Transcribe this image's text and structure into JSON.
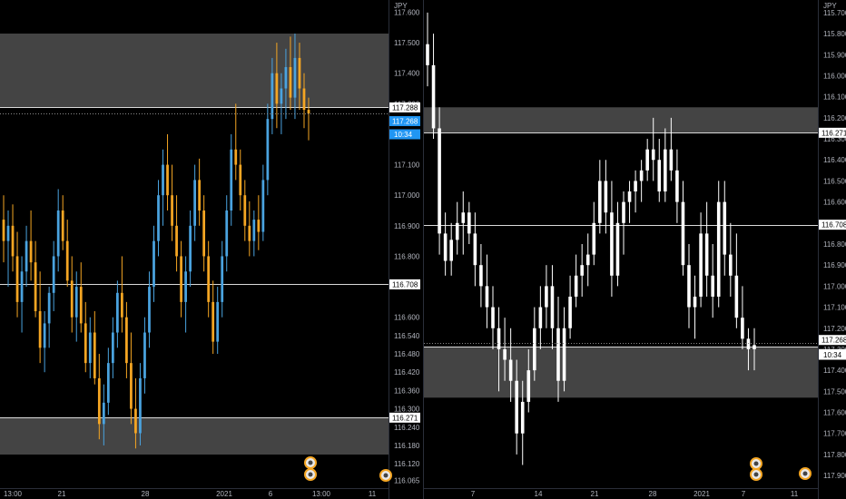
{
  "colors": {
    "background": "#000000",
    "zone": "#444444",
    "level_line": "#d9d9d9",
    "left_up": "#4aa3df",
    "left_down": "#f5a623",
    "right_candle": "#ffffff",
    "price_badge": "#2196f3",
    "axis_text": "#b2b5be"
  },
  "left": {
    "currency": "JPY",
    "price_labels": [
      "117.600",
      "117.500",
      "117.400",
      "117.300",
      "117.200",
      "117.100",
      "117.000",
      "116.900",
      "116.800",
      "116.700",
      "116.600",
      "116.540",
      "116.480",
      "116.420",
      "116.360",
      "116.300",
      "116.240",
      "116.180",
      "116.120",
      "116.065"
    ],
    "level_labels": [
      "117.288",
      "116.708",
      "116.271"
    ],
    "last_price": "117.268",
    "countdown": "10:34",
    "time_labels": [
      "13:00",
      "21",
      "28",
      "2021",
      "6",
      "13:00",
      "11"
    ]
  },
  "right": {
    "currency": "JPY",
    "scale_mode": "inverted",
    "price_labels": [
      "115.700",
      "115.800",
      "115.900",
      "116.000",
      "116.100",
      "116.200",
      "116.300",
      "116.400",
      "116.500",
      "116.600",
      "116.700",
      "116.800",
      "116.900",
      "117.000",
      "117.100",
      "117.200",
      "117.300",
      "117.400",
      "117.500",
      "117.600",
      "117.700",
      "117.800",
      "117.900"
    ],
    "level_labels": [
      "116.271",
      "116.708",
      "117.268",
      "117.288"
    ],
    "countdown": "10:34",
    "time_labels": [
      "7",
      "14",
      "21",
      "28",
      "2021",
      "7",
      "11"
    ]
  },
  "chart_data": [
    {
      "type": "candlestick",
      "title": "",
      "ylabel": "JPY",
      "ylim": [
        116.04,
        117.64
      ],
      "x_ticks": [
        "13:00",
        "21",
        "28",
        "2021",
        "6",
        "13:00",
        "11"
      ],
      "levels": [
        117.288,
        116.708,
        116.271
      ],
      "zones": [
        [
          117.288,
          117.53
        ],
        [
          116.15,
          116.271
        ]
      ],
      "last_price": 117.268,
      "candles": [
        {
          "o": 116.92,
          "h": 117.0,
          "l": 116.78,
          "c": 116.85
        },
        {
          "o": 116.85,
          "h": 116.95,
          "l": 116.7,
          "c": 116.9
        },
        {
          "o": 116.9,
          "h": 116.97,
          "l": 116.75,
          "c": 116.8
        },
        {
          "o": 116.8,
          "h": 116.88,
          "l": 116.6,
          "c": 116.65
        },
        {
          "o": 116.65,
          "h": 116.8,
          "l": 116.55,
          "c": 116.75
        },
        {
          "o": 116.75,
          "h": 116.9,
          "l": 116.7,
          "c": 116.85
        },
        {
          "o": 116.85,
          "h": 116.95,
          "l": 116.72,
          "c": 116.78
        },
        {
          "o": 116.78,
          "h": 116.85,
          "l": 116.6,
          "c": 116.62
        },
        {
          "o": 116.62,
          "h": 116.75,
          "l": 116.45,
          "c": 116.5
        },
        {
          "o": 116.5,
          "h": 116.62,
          "l": 116.42,
          "c": 116.58
        },
        {
          "o": 116.58,
          "h": 116.7,
          "l": 116.5,
          "c": 116.68
        },
        {
          "o": 116.68,
          "h": 116.85,
          "l": 116.62,
          "c": 116.8
        },
        {
          "o": 116.8,
          "h": 117.02,
          "l": 116.75,
          "c": 116.95
        },
        {
          "o": 116.95,
          "h": 117.0,
          "l": 116.82,
          "c": 116.85
        },
        {
          "o": 116.85,
          "h": 116.92,
          "l": 116.7,
          "c": 116.72
        },
        {
          "o": 116.72,
          "h": 116.8,
          "l": 116.55,
          "c": 116.6
        },
        {
          "o": 116.6,
          "h": 116.75,
          "l": 116.52,
          "c": 116.7
        },
        {
          "o": 116.7,
          "h": 116.78,
          "l": 116.55,
          "c": 116.58
        },
        {
          "o": 116.58,
          "h": 116.65,
          "l": 116.42,
          "c": 116.45
        },
        {
          "o": 116.45,
          "h": 116.6,
          "l": 116.4,
          "c": 116.55
        },
        {
          "o": 116.55,
          "h": 116.62,
          "l": 116.38,
          "c": 116.4
        },
        {
          "o": 116.4,
          "h": 116.48,
          "l": 116.2,
          "c": 116.25
        },
        {
          "o": 116.25,
          "h": 116.38,
          "l": 116.18,
          "c": 116.32
        },
        {
          "o": 116.32,
          "h": 116.5,
          "l": 116.28,
          "c": 116.45
        },
        {
          "o": 116.45,
          "h": 116.6,
          "l": 116.4,
          "c": 116.55
        },
        {
          "o": 116.55,
          "h": 116.72,
          "l": 116.5,
          "c": 116.68
        },
        {
          "o": 116.68,
          "h": 116.8,
          "l": 116.55,
          "c": 116.6
        },
        {
          "o": 116.6,
          "h": 116.65,
          "l": 116.4,
          "c": 116.45
        },
        {
          "o": 116.45,
          "h": 116.55,
          "l": 116.25,
          "c": 116.3
        },
        {
          "o": 116.3,
          "h": 116.4,
          "l": 116.17,
          "c": 116.22
        },
        {
          "o": 116.22,
          "h": 116.45,
          "l": 116.18,
          "c": 116.4
        },
        {
          "o": 116.4,
          "h": 116.6,
          "l": 116.35,
          "c": 116.55
        },
        {
          "o": 116.55,
          "h": 116.75,
          "l": 116.5,
          "c": 116.7
        },
        {
          "o": 116.7,
          "h": 116.9,
          "l": 116.65,
          "c": 116.85
        },
        {
          "o": 116.85,
          "h": 117.05,
          "l": 116.8,
          "c": 117.0
        },
        {
          "o": 117.0,
          "h": 117.15,
          "l": 116.9,
          "c": 117.1
        },
        {
          "o": 117.1,
          "h": 117.2,
          "l": 116.95,
          "c": 117.0
        },
        {
          "o": 117.0,
          "h": 117.1,
          "l": 116.85,
          "c": 116.9
        },
        {
          "o": 116.9,
          "h": 117.0,
          "l": 116.75,
          "c": 116.8
        },
        {
          "o": 116.8,
          "h": 116.85,
          "l": 116.6,
          "c": 116.65
        },
        {
          "o": 116.65,
          "h": 116.8,
          "l": 116.55,
          "c": 116.75
        },
        {
          "o": 116.75,
          "h": 116.95,
          "l": 116.7,
          "c": 116.9
        },
        {
          "o": 116.9,
          "h": 117.1,
          "l": 116.85,
          "c": 117.05
        },
        {
          "o": 117.05,
          "h": 117.12,
          "l": 116.9,
          "c": 116.95
        },
        {
          "o": 116.95,
          "h": 117.0,
          "l": 116.75,
          "c": 116.8
        },
        {
          "o": 116.8,
          "h": 116.85,
          "l": 116.6,
          "c": 116.65
        },
        {
          "o": 116.65,
          "h": 116.72,
          "l": 116.48,
          "c": 116.52
        },
        {
          "o": 116.52,
          "h": 116.7,
          "l": 116.48,
          "c": 116.65
        },
        {
          "o": 116.65,
          "h": 116.85,
          "l": 116.6,
          "c": 116.8
        },
        {
          "o": 116.8,
          "h": 117.0,
          "l": 116.75,
          "c": 116.95
        },
        {
          "o": 116.95,
          "h": 117.2,
          "l": 116.9,
          "c": 117.15
        },
        {
          "o": 117.15,
          "h": 117.3,
          "l": 117.05,
          "c": 117.1
        },
        {
          "o": 117.1,
          "h": 117.15,
          "l": 116.95,
          "c": 117.0
        },
        {
          "o": 117.0,
          "h": 117.05,
          "l": 116.85,
          "c": 116.9
        },
        {
          "o": 116.9,
          "h": 116.98,
          "l": 116.8,
          "c": 116.85
        },
        {
          "o": 116.85,
          "h": 116.95,
          "l": 116.8,
          "c": 116.92
        },
        {
          "o": 116.92,
          "h": 117.0,
          "l": 116.82,
          "c": 116.88
        },
        {
          "o": 116.88,
          "h": 117.1,
          "l": 116.85,
          "c": 117.05
        },
        {
          "o": 117.05,
          "h": 117.3,
          "l": 117.0,
          "c": 117.25
        },
        {
          "o": 117.25,
          "h": 117.45,
          "l": 117.2,
          "c": 117.4
        },
        {
          "o": 117.4,
          "h": 117.5,
          "l": 117.22,
          "c": 117.3
        },
        {
          "o": 117.3,
          "h": 117.4,
          "l": 117.2,
          "c": 117.35
        },
        {
          "o": 117.35,
          "h": 117.48,
          "l": 117.25,
          "c": 117.42
        },
        {
          "o": 117.42,
          "h": 117.52,
          "l": 117.28,
          "c": 117.32
        },
        {
          "o": 117.32,
          "h": 117.53,
          "l": 117.25,
          "c": 117.45
        },
        {
          "o": 117.45,
          "h": 117.5,
          "l": 117.28,
          "c": 117.35
        },
        {
          "o": 117.35,
          "h": 117.4,
          "l": 117.22,
          "c": 117.28
        },
        {
          "o": 117.28,
          "h": 117.32,
          "l": 117.18,
          "c": 117.268
        }
      ]
    },
    {
      "type": "candlestick",
      "title": "",
      "ylabel": "JPY",
      "inverted": true,
      "ylim": [
        115.64,
        117.96
      ],
      "x_ticks": [
        "7",
        "14",
        "21",
        "28",
        "2021",
        "7",
        "11"
      ],
      "levels": [
        116.271,
        116.708,
        117.288
      ],
      "zones": [
        [
          116.15,
          116.271
        ],
        [
          117.288,
          117.53
        ]
      ],
      "last_price": 117.268,
      "candles": [
        {
          "o": 115.85,
          "h": 115.7,
          "l": 116.05,
          "c": 115.95
        },
        {
          "o": 115.95,
          "h": 115.8,
          "l": 116.3,
          "c": 116.25
        },
        {
          "o": 116.25,
          "h": 116.15,
          "l": 116.85,
          "c": 116.75
        },
        {
          "o": 116.75,
          "h": 116.65,
          "l": 116.95,
          "c": 116.88
        },
        {
          "o": 116.88,
          "h": 116.7,
          "l": 116.95,
          "c": 116.78
        },
        {
          "o": 116.78,
          "h": 116.6,
          "l": 116.85,
          "c": 116.7
        },
        {
          "o": 116.7,
          "h": 116.55,
          "l": 116.85,
          "c": 116.65
        },
        {
          "o": 116.65,
          "h": 116.6,
          "l": 116.8,
          "c": 116.75
        },
        {
          "o": 116.75,
          "h": 116.65,
          "l": 117.0,
          "c": 116.9
        },
        {
          "o": 116.9,
          "h": 116.8,
          "l": 117.1,
          "c": 117.0
        },
        {
          "o": 117.0,
          "h": 116.85,
          "l": 117.2,
          "c": 117.1
        },
        {
          "o": 117.1,
          "h": 117.0,
          "l": 117.3,
          "c": 117.2
        },
        {
          "o": 117.2,
          "h": 117.1,
          "l": 117.5,
          "c": 117.3
        },
        {
          "o": 117.3,
          "h": 117.15,
          "l": 117.45,
          "c": 117.35
        },
        {
          "o": 117.35,
          "h": 117.2,
          "l": 117.55,
          "c": 117.45
        },
        {
          "o": 117.45,
          "h": 117.35,
          "l": 117.8,
          "c": 117.7
        },
        {
          "o": 117.7,
          "h": 117.45,
          "l": 117.85,
          "c": 117.55
        },
        {
          "o": 117.55,
          "h": 117.3,
          "l": 117.6,
          "c": 117.4
        },
        {
          "o": 117.4,
          "h": 117.1,
          "l": 117.45,
          "c": 117.2
        },
        {
          "o": 117.2,
          "h": 117.0,
          "l": 117.3,
          "c": 117.1
        },
        {
          "o": 117.1,
          "h": 116.9,
          "l": 117.2,
          "c": 117.0
        },
        {
          "o": 117.0,
          "h": 116.9,
          "l": 117.3,
          "c": 117.2
        },
        {
          "o": 117.2,
          "h": 117.05,
          "l": 117.55,
          "c": 117.45
        },
        {
          "o": 117.45,
          "h": 117.1,
          "l": 117.5,
          "c": 117.2
        },
        {
          "o": 117.2,
          "h": 116.95,
          "l": 117.25,
          "c": 117.05
        },
        {
          "o": 117.05,
          "h": 116.85,
          "l": 117.1,
          "c": 116.95
        },
        {
          "o": 116.95,
          "h": 116.8,
          "l": 117.05,
          "c": 116.9
        },
        {
          "o": 116.9,
          "h": 116.75,
          "l": 117.0,
          "c": 116.85
        },
        {
          "o": 116.85,
          "h": 116.6,
          "l": 116.9,
          "c": 116.7
        },
        {
          "o": 116.7,
          "h": 116.4,
          "l": 116.75,
          "c": 116.5
        },
        {
          "o": 116.5,
          "h": 116.4,
          "l": 116.75,
          "c": 116.65
        },
        {
          "o": 116.65,
          "h": 116.5,
          "l": 117.05,
          "c": 116.95
        },
        {
          "o": 116.95,
          "h": 116.6,
          "l": 117.0,
          "c": 116.7
        },
        {
          "o": 116.7,
          "h": 116.55,
          "l": 116.85,
          "c": 116.6
        },
        {
          "o": 116.6,
          "h": 116.5,
          "l": 116.7,
          "c": 116.55
        },
        {
          "o": 116.55,
          "h": 116.45,
          "l": 116.65,
          "c": 116.5
        },
        {
          "o": 116.5,
          "h": 116.4,
          "l": 116.6,
          "c": 116.45
        },
        {
          "o": 116.45,
          "h": 116.3,
          "l": 116.5,
          "c": 116.35
        },
        {
          "o": 116.35,
          "h": 116.2,
          "l": 116.5,
          "c": 116.4
        },
        {
          "o": 116.4,
          "h": 116.3,
          "l": 116.6,
          "c": 116.55
        },
        {
          "o": 116.55,
          "h": 116.25,
          "l": 116.6,
          "c": 116.35
        },
        {
          "o": 116.35,
          "h": 116.2,
          "l": 116.5,
          "c": 116.45
        },
        {
          "o": 116.45,
          "h": 116.35,
          "l": 116.7,
          "c": 116.6
        },
        {
          "o": 116.6,
          "h": 116.5,
          "l": 116.95,
          "c": 116.9
        },
        {
          "o": 116.9,
          "h": 116.8,
          "l": 117.2,
          "c": 117.1
        },
        {
          "o": 117.1,
          "h": 116.95,
          "l": 117.25,
          "c": 117.05
        },
        {
          "o": 117.05,
          "h": 116.65,
          "l": 117.1,
          "c": 116.75
        },
        {
          "o": 116.75,
          "h": 116.6,
          "l": 117.05,
          "c": 116.95
        },
        {
          "o": 116.95,
          "h": 116.8,
          "l": 117.15,
          "c": 117.05
        },
        {
          "o": 117.05,
          "h": 116.5,
          "l": 117.1,
          "c": 116.6
        },
        {
          "o": 116.6,
          "h": 116.5,
          "l": 116.95,
          "c": 116.85
        },
        {
          "o": 116.85,
          "h": 116.7,
          "l": 117.05,
          "c": 116.95
        },
        {
          "o": 116.95,
          "h": 116.75,
          "l": 117.2,
          "c": 117.15
        },
        {
          "o": 117.15,
          "h": 117.0,
          "l": 117.3,
          "c": 117.25
        },
        {
          "o": 117.25,
          "h": 117.2,
          "l": 117.4,
          "c": 117.3
        },
        {
          "o": 117.3,
          "h": 117.2,
          "l": 117.4,
          "c": 117.28
        }
      ]
    }
  ]
}
